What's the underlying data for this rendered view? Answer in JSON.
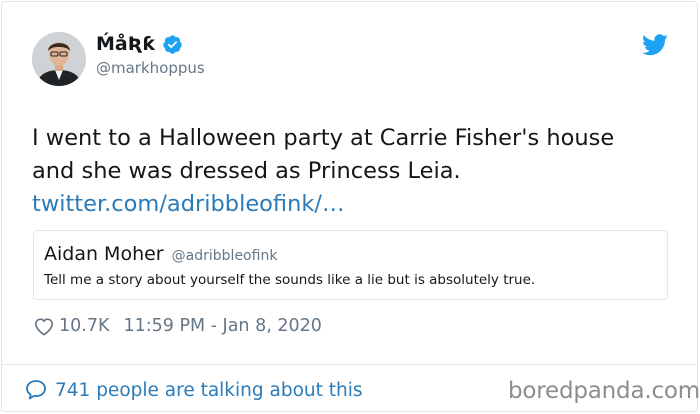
{
  "tweet": {
    "display_name": "ḾåƦƙ",
    "handle": "@markhoppus",
    "text_lines": [
      "I went to a Halloween party at Carrie Fisher's house",
      "and she was dressed as Princess Leia."
    ],
    "link": "twitter.com/adribbleofink/…",
    "likes": "10.7K",
    "timestamp": "11:59 PM - Jan 8, 2020",
    "conversation": "741 people are talking about this"
  },
  "quoted_tweet": {
    "name": "Aidan Moher",
    "handle": "@adribbleofink",
    "text": "Tell me a story about yourself the sounds like a lie but is absolutely true."
  },
  "watermark": "boredpanda.com",
  "icons": {
    "avatar": "avatar",
    "verified": "verified-badge-icon",
    "twitter": "twitter-bird-icon",
    "heart": "heart-icon",
    "conversation": "speech-bubble-icon"
  },
  "colors": {
    "link": "#2b7bb9",
    "twitter_blue": "#1da1f2",
    "muted": "#657786",
    "text": "#14171a",
    "border": "#e1e8ed"
  }
}
